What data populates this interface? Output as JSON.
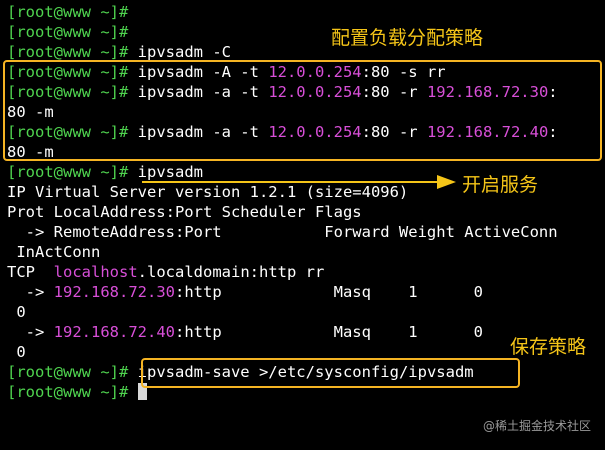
{
  "prompt": "[root@www ~]#",
  "lines": [
    {
      "prompt": "[root@www ~]#",
      "parts": []
    },
    {
      "prompt": "[root@www ~]#",
      "parts": []
    },
    {
      "prompt": "[root@www ~]#",
      "parts": [
        {
          "t": " ipvsadm -C",
          "c": "white"
        }
      ]
    },
    {
      "prompt": "[root@www ~]#",
      "parts": [
        {
          "t": " ipvsadm -A -t ",
          "c": "white"
        },
        {
          "t": "12.0.0.254",
          "c": "magenta"
        },
        {
          "t": ":80 -s rr",
          "c": "white"
        }
      ]
    },
    {
      "prompt": "[root@www ~]#",
      "parts": [
        {
          "t": " ipvsadm -a -t ",
          "c": "white"
        },
        {
          "t": "12.0.0.254",
          "c": "magenta"
        },
        {
          "t": ":80 -r ",
          "c": "white"
        },
        {
          "t": "192.168.72.30",
          "c": "magenta"
        },
        {
          "t": ":",
          "c": "white"
        }
      ]
    },
    {
      "prompt": "",
      "parts": [
        {
          "t": "80 -m",
          "c": "white"
        }
      ]
    },
    {
      "prompt": "[root@www ~]#",
      "parts": [
        {
          "t": " ipvsadm -a -t ",
          "c": "white"
        },
        {
          "t": "12.0.0.254",
          "c": "magenta"
        },
        {
          "t": ":80 -r ",
          "c": "white"
        },
        {
          "t": "192.168.72.40",
          "c": "magenta"
        },
        {
          "t": ":",
          "c": "white"
        }
      ]
    },
    {
      "prompt": "",
      "parts": [
        {
          "t": "80 -m",
          "c": "white"
        }
      ]
    },
    {
      "prompt": "[root@www ~]#",
      "parts": [
        {
          "t": " ipvsadm",
          "c": "white"
        }
      ]
    },
    {
      "prompt": "",
      "parts": [
        {
          "t": "IP Virtual Server version 1.2.1 (size=4096)",
          "c": "white"
        }
      ]
    },
    {
      "prompt": "",
      "parts": [
        {
          "t": "Prot LocalAddress:Port Scheduler Flags",
          "c": "white"
        }
      ]
    },
    {
      "prompt": "",
      "parts": [
        {
          "t": "  -> RemoteAddress:Port           Forward Weight ActiveConn",
          "c": "white"
        }
      ]
    },
    {
      "prompt": "",
      "parts": [
        {
          "t": " InActConn",
          "c": "white"
        }
      ]
    },
    {
      "prompt": "",
      "parts": [
        {
          "t": "TCP  ",
          "c": "white"
        },
        {
          "t": "localhost",
          "c": "magenta"
        },
        {
          "t": ".localdomain:http rr",
          "c": "white"
        }
      ]
    },
    {
      "prompt": "",
      "parts": [
        {
          "t": "  -> ",
          "c": "white"
        },
        {
          "t": "192.168.72.30",
          "c": "magenta"
        },
        {
          "t": ":http            Masq    1      0",
          "c": "white"
        }
      ]
    },
    {
      "prompt": "",
      "parts": [
        {
          "t": " 0",
          "c": "white"
        }
      ]
    },
    {
      "prompt": "",
      "parts": [
        {
          "t": "  -> ",
          "c": "white"
        },
        {
          "t": "192.168.72.40",
          "c": "magenta"
        },
        {
          "t": ":http            Masq    1      0",
          "c": "white"
        }
      ]
    },
    {
      "prompt": "",
      "parts": [
        {
          "t": " 0",
          "c": "white"
        }
      ]
    },
    {
      "prompt": "[root@www ~]#",
      "parts": [
        {
          "t": " ipvsadm-save >/etc/sysconfig/ipvsadm",
          "c": "white"
        }
      ]
    },
    {
      "prompt": "[root@www ~]#",
      "parts": [
        {
          "t": " ",
          "c": "white"
        }
      ],
      "cursor": true
    }
  ],
  "annotations": {
    "config": "配置负载分配策略",
    "start": "开启服务",
    "save": "保存策略"
  },
  "watermark": "@稀土掘金技术社区",
  "colors": {
    "background": "#000000",
    "prompt": "#4fd44f",
    "magenta": "#d84fd8",
    "highlight": "#f5b423"
  }
}
